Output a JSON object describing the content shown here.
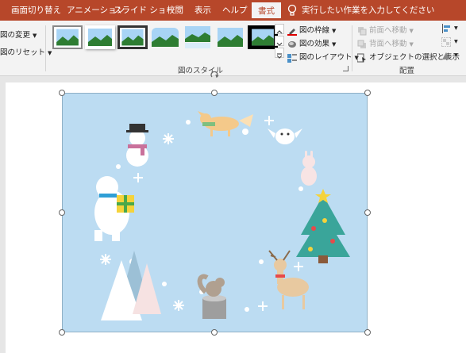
{
  "tabs": [
    {
      "label": "画面切り替え"
    },
    {
      "label": "アニメーション"
    },
    {
      "label": "スライド ショー"
    },
    {
      "label": "校閲"
    },
    {
      "label": "表示"
    },
    {
      "label": "ヘルプ"
    },
    {
      "label": "書式"
    }
  ],
  "tell_me": "実行したい作業を入力してください",
  "ribbon": {
    "change_picture": "図の変更",
    "reset_picture": "図のリセット",
    "picture_border": "図の枠線",
    "picture_effects": "図の効果",
    "picture_layout": "図のレイアウト",
    "bring_forward": "前面へ移動",
    "send_backward": "背面へ移動",
    "selection_pane": "オブジェクトの選択と表示",
    "group_picture_styles": "図のスタイル",
    "group_arrange": "配置"
  },
  "colors": {
    "accent": "#b7472a",
    "ribbon_bg": "#f3f3f3",
    "picture_bg": "#bcdcf2"
  },
  "picture_elements": [
    "snowman",
    "fox",
    "owl",
    "rabbit",
    "polar-bear",
    "gift",
    "christmas-tree",
    "reindeer",
    "squirrel",
    "snowy-trees",
    "snowflakes"
  ]
}
